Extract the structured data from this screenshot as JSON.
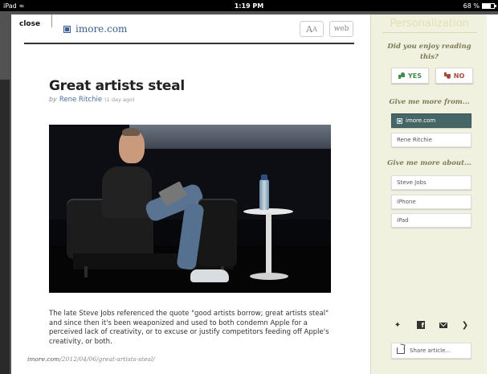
{
  "status_bar": {
    "device": "iPad",
    "time": "1:19 PM",
    "battery": "68 %",
    "battery_level": 0.68
  },
  "reader": {
    "close_label": "close",
    "site_name": "imore.com",
    "font_button_label": "A",
    "font_button_small": "A",
    "web_button_label": "web",
    "footer_domain": "imore.com",
    "footer_path": "/2012/04/06/great-artists-steal/"
  },
  "article": {
    "title": "Great artists steal",
    "by": "by",
    "author": "Rene Ritchie",
    "time_ago": "(1 day ago)",
    "body": "The late Steve Jobs referenced the quote \"good artists borrow; great artists steal\" and since then it's been weaponized and used to both condemn Apple for a perceived lack of creativity, or to excuse or justify competitors feeding off Apple's creativity, or both."
  },
  "personalization": {
    "title": "Personalization",
    "question": "Did you enjoy reading this?",
    "yes_label": "YES",
    "no_label": "NO",
    "more_from_heading": "Give me more from...",
    "more_from": [
      "imore.com",
      "Rene Ritchie"
    ],
    "more_about_heading": "Give me more about...",
    "more_about": [
      "Steve Jobs",
      "iPhone",
      "iPad"
    ],
    "share_label": "Share article...",
    "accent_color": "#466566"
  }
}
